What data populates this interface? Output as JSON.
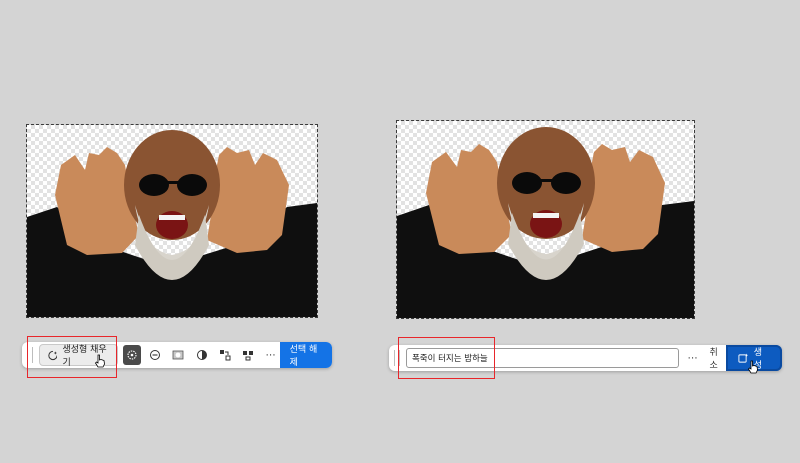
{
  "left_panel": {
    "canvas": {
      "image_alt": "photo subject with selection marquee"
    },
    "taskbar": {
      "generative_fill_label": "생성형 채우기",
      "deselect_label": "선택 해제",
      "more_icon": "⋯",
      "tools": [
        "select-subject-icon",
        "subtract-icon",
        "mask-icon",
        "invert-icon",
        "transform-icon",
        "fill-icon",
        "more-icon"
      ]
    }
  },
  "right_panel": {
    "canvas": {
      "image_alt": "photo subject with selection marquee"
    },
    "taskbar": {
      "prompt_value": "폭죽이 터지는 밤하늘",
      "more_icon": "⋯",
      "cancel_label": "취소",
      "generate_label": "생성"
    }
  },
  "colors": {
    "accent_blue": "#1473e6",
    "generate_blue": "#0d5bc0",
    "highlight_red": "#e8262b",
    "background": "#d4d4d4"
  }
}
